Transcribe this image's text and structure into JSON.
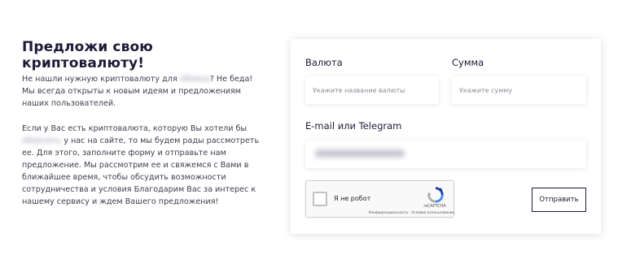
{
  "left": {
    "title": "Предложи свою криптовалюту!",
    "para1": {
      "before": "Не нашли нужную криптовалюту для ",
      "blurred": "обменa",
      "after": "? Не беда! Мы всегда открыты к новым идеям и предложениям наших пользователей."
    },
    "para2": {
      "before": "Если у Вас есть криптовалюта, которую Вы хотели бы ",
      "blurred": "обменять",
      "after": " у нас на сайте, то мы будем рады рассмотреть ее. Для этого, заполните форму и отправьте нам предложение. Мы рассмотрим ее и свяжемся с Вами в ближайшее время, чтобы обсудить возможности сотрудничества и условия Благодарим Вас за интерес к нашему сервису и ждем Вашего предложения!"
    }
  },
  "form": {
    "currency_label": "Валюта",
    "currency_placeholder": "Укажите название валюты",
    "amount_label": "Сумма",
    "amount_placeholder": "Укажите сумму",
    "contact_label": "E-mail или Telegram",
    "contact_value": "",
    "submit_label": "Отправить"
  },
  "recaptcha": {
    "checkbox_label": "Я не робот",
    "brand": "reCAPTCHA",
    "links": "Конфиденциальность - Условия использования",
    "icon": "recaptcha-logo-icon"
  }
}
